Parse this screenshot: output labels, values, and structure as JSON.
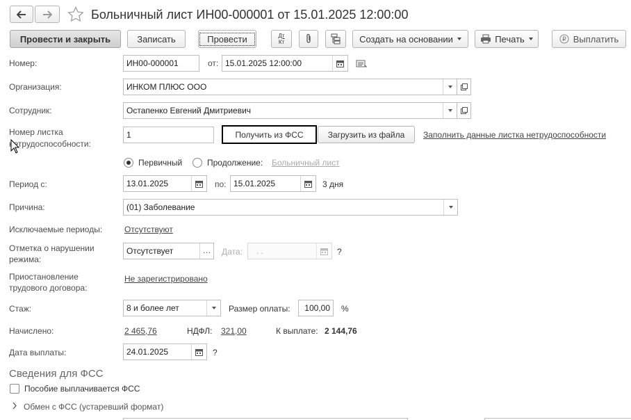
{
  "window": {
    "title": "Больничный лист ИН00-000001 от 15.01.2025 12:00:00"
  },
  "toolbar": {
    "post_and_close": "Провести и закрыть",
    "save": "Записать",
    "post": "Провести",
    "dtkt_top": "Дт",
    "dtkt_bottom": "Кт",
    "create_based_on": "Создать на основании",
    "print": "Печать",
    "pay": "Выплатить"
  },
  "form": {
    "number_label": "Номер:",
    "number_value": "ИН00-000001",
    "from_label": "от:",
    "date_value": "15.01.2025 12:00:00",
    "organization_label": "Организация:",
    "organization_value": "ИНКОМ ПЛЮС ООО",
    "employee_label": "Сотрудник:",
    "employee_value": "Остапенко Евгений Дмитриевич",
    "sheet_number_label_1": "Номер листка",
    "sheet_number_label_2": "нетрудоспособности:",
    "sheet_number_value": "1",
    "get_from_fss": "Получить из ФСС",
    "load_from_file": "Загрузить из файла",
    "fill_sheet_data": "Заполнить данные листка нетрудоспособности",
    "primary_label": "Первичный",
    "continuation_label": "Продолжение:",
    "sick_leave_link": "Больничный лист",
    "period_label": "Период с:",
    "period_from": "13.01.2025",
    "period_to_label": "по:",
    "period_to": "15.01.2025",
    "days": "3 дня",
    "reason_label": "Причина:",
    "reason_value": "(01) Заболевание",
    "excluded_label": "Исключаемые периоды:",
    "excluded_value": "Отсутствуют",
    "violation_label_1": "Отметка о нарушении",
    "violation_label_2": "режима:",
    "violation_value": "Отсутствует",
    "violation_date_label": "Дата:",
    "violation_date_value": " .  .",
    "question_mark": "?",
    "suspension_label_1": "Приостановление",
    "suspension_label_2": "трудового договора:",
    "suspension_value": "Не зарегистрировано",
    "experience_label": "Стаж:",
    "experience_value": "8 и более лет",
    "pay_size_label": "Размер оплаты:",
    "pay_size_value": "100,00",
    "percent": "%",
    "accrued_label": "Начислено:",
    "accrued_value": "2 465,76",
    "ndfl_label": "НДФЛ:",
    "ndfl_value": "321,00",
    "to_pay_label": "К выплате:",
    "to_pay_value": "2 144,76",
    "pay_date_label": "Дата выплаты:",
    "pay_date_value": "24.01.2025"
  },
  "fss": {
    "section_title": "Сведения для ФСС",
    "benefit_paid_by_fss": "Пособие выплачивается ФСС",
    "exchange_label": "Обмен с ФСС (устаревший формат)"
  },
  "colors": {
    "accent_border": "#000000",
    "link": "#444444",
    "muted": "#aaaaaa"
  }
}
